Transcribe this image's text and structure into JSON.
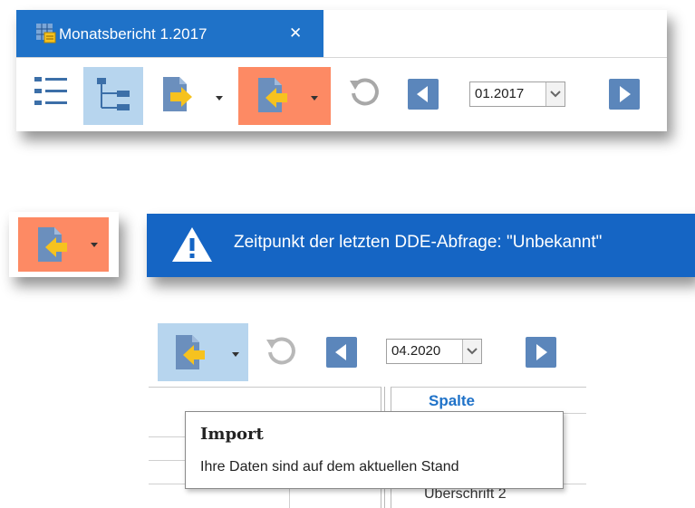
{
  "tab": {
    "title": "Monatsbericht 1.2017",
    "close_glyph": "✕"
  },
  "toolbar1": {
    "date_value": "01.2017"
  },
  "banner": {
    "message": "Zeitpunkt der letzten DDE-Abfrage: \"Unbekannt\""
  },
  "toolbar2": {
    "date_value": "04.2020"
  },
  "grid": {
    "column_header": "Spalte",
    "row_label": "Überschrift 2"
  },
  "tooltip": {
    "title": "Import",
    "text": "Ihre Daten sind auf dem aktuellen Stand"
  },
  "colors": {
    "tab_blue": "#1f72c8",
    "active_blue": "#b7d5ee",
    "import_orange": "#fd8a64",
    "nav_blue": "#5b86bb",
    "banner_blue": "#1565c4"
  }
}
